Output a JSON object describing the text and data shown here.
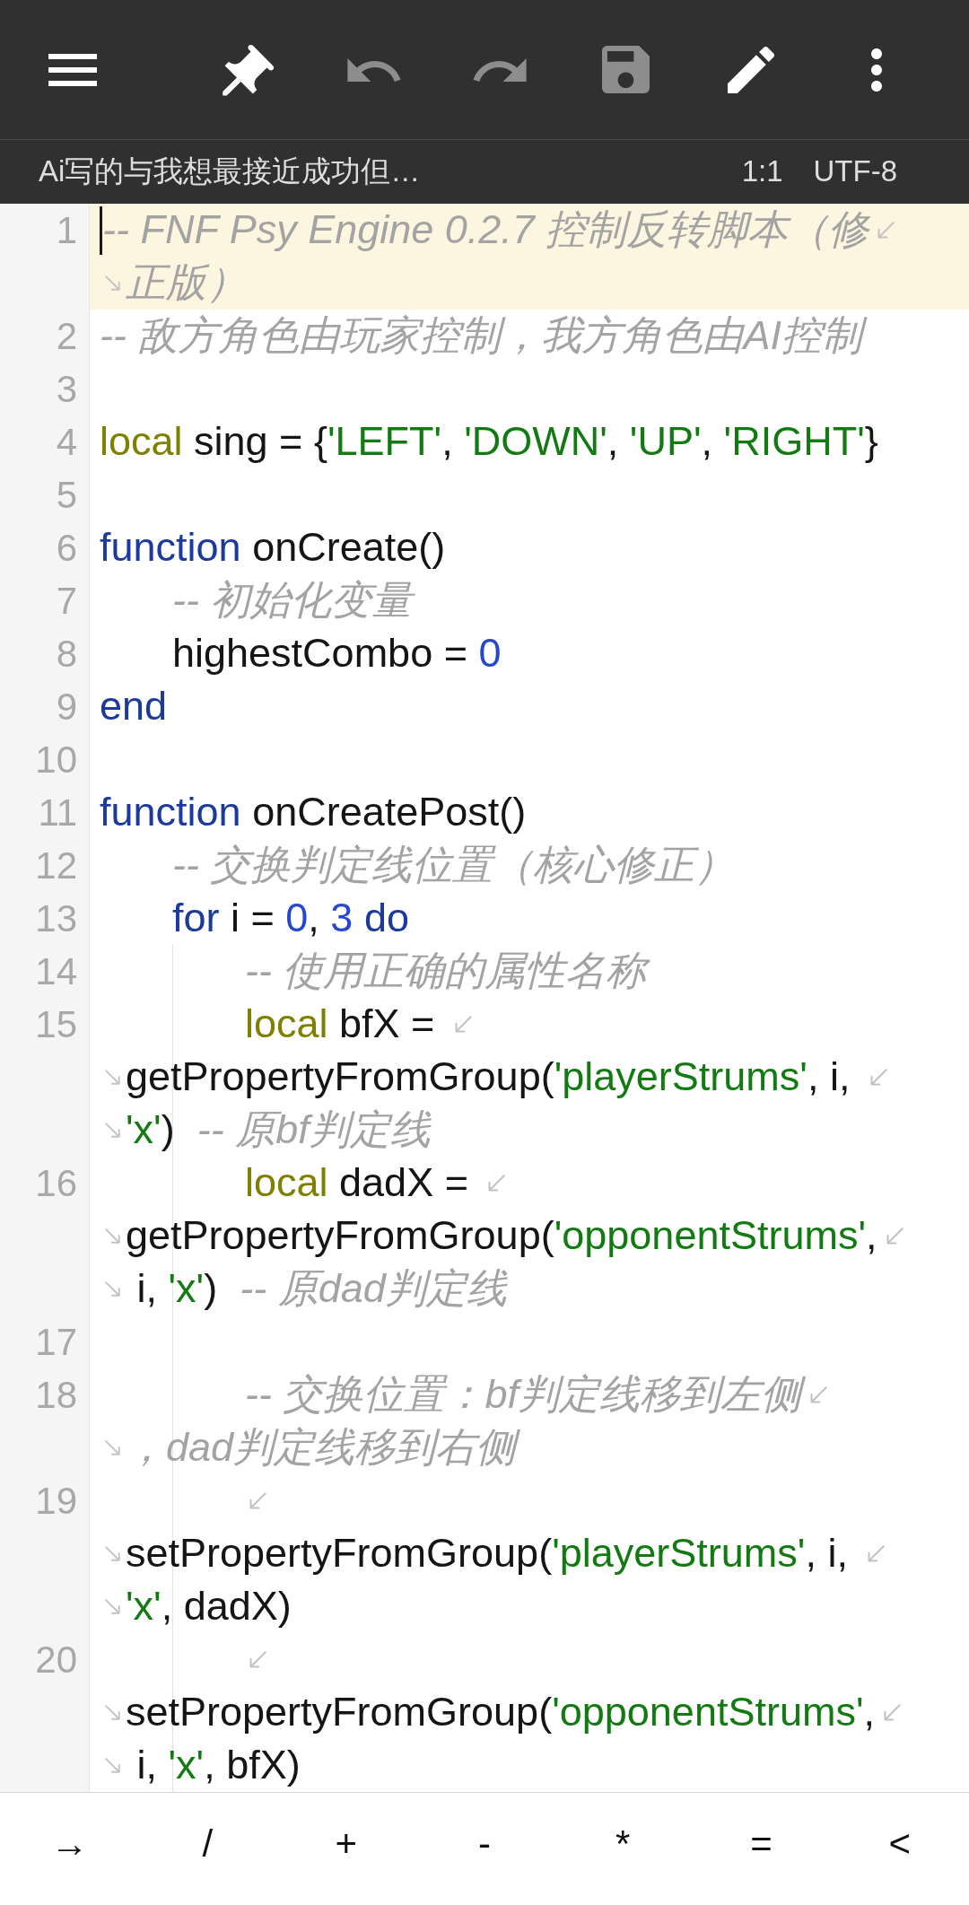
{
  "toolbar": {
    "buttons": [
      {
        "kind": "menu",
        "disabled": false
      },
      {
        "kind": "pin",
        "disabled": false
      },
      {
        "kind": "undo",
        "disabled": true
      },
      {
        "kind": "redo",
        "disabled": true
      },
      {
        "kind": "save",
        "disabled": true
      },
      {
        "kind": "edit",
        "disabled": false
      },
      {
        "kind": "more",
        "disabled": false
      }
    ]
  },
  "status_bar": {
    "file_name": "Ai写的与我想最接近成功但…",
    "cursor_position": "1:1",
    "encoding": "UTF-8"
  },
  "editor": {
    "lines": [
      {
        "number": "1",
        "current": true,
        "rows": [
          {
            "wrap_start": false,
            "wrap_end": true,
            "segments": [
              {
                "kind": "comment",
                "text": "-- FNF Psy Engine 0.2.7 控制反转脚本（修"
              }
            ]
          },
          {
            "wrap_start": true,
            "wrap_end": false,
            "segments": [
              {
                "kind": "comment",
                "text": "正版）"
              }
            ]
          }
        ]
      },
      {
        "number": "2",
        "current": false,
        "rows": [
          {
            "wrap_start": false,
            "wrap_end": false,
            "segments": [
              {
                "kind": "comment",
                "text": "-- 敌方角色由玩家控制，我方角色由AI控制"
              }
            ]
          }
        ]
      },
      {
        "number": "3",
        "current": false
      },
      {
        "number": "4",
        "current": false,
        "rows": [
          {
            "wrap_start": false,
            "wrap_end": false,
            "segments": [
              {
                "kind": "modifier",
                "text": "local"
              },
              {
                "kind": "plain",
                "text": " sing = {"
              },
              {
                "kind": "string",
                "text": "'LEFT'"
              },
              {
                "kind": "plain",
                "text": ", "
              },
              {
                "kind": "string",
                "text": "'DOWN'"
              },
              {
                "kind": "plain",
                "text": ", "
              },
              {
                "kind": "string",
                "text": "'UP'"
              },
              {
                "kind": "plain",
                "text": ", "
              },
              {
                "kind": "string",
                "text": "'RIGHT'"
              },
              {
                "kind": "plain",
                "text": "}"
              }
            ]
          }
        ]
      },
      {
        "number": "5",
        "current": false
      },
      {
        "number": "6",
        "current": false,
        "rows": [
          {
            "wrap_start": false,
            "wrap_end": false,
            "segments": [
              {
                "kind": "keyword",
                "text": "function"
              },
              {
                "kind": "plain",
                "text": " onCreate()"
              }
            ]
          }
        ],
        "children": [
          {
            "number": "7",
            "current": false,
            "rows": [
              {
                "wrap_start": false,
                "wrap_end": false,
                "segments": [
                  {
                    "kind": "comment",
                    "text": "-- 初始化变量"
                  }
                ]
              }
            ]
          },
          {
            "number": "8",
            "current": false,
            "rows": [
              {
                "wrap_start": false,
                "wrap_end": false,
                "segments": [
                  {
                    "kind": "plain",
                    "text": "highestCombo = "
                  },
                  {
                    "kind": "number",
                    "text": "0"
                  }
                ]
              }
            ]
          }
        ]
      },
      {
        "number": "9",
        "current": false,
        "rows": [
          {
            "wrap_start": false,
            "wrap_end": false,
            "segments": [
              {
                "kind": "keyword",
                "text": "end"
              }
            ]
          }
        ]
      },
      {
        "number": "10",
        "current": false
      },
      {
        "number": "11",
        "current": false,
        "rows": [
          {
            "wrap_start": false,
            "wrap_end": false,
            "segments": [
              {
                "kind": "keyword",
                "text": "function"
              },
              {
                "kind": "plain",
                "text": " onCreatePost()"
              }
            ]
          }
        ],
        "children": [
          {
            "number": "12",
            "current": false,
            "rows": [
              {
                "wrap_start": false,
                "wrap_end": false,
                "segments": [
                  {
                    "kind": "comment",
                    "text": "-- 交换判定线位置（核心修正）"
                  }
                ]
              }
            ]
          },
          {
            "number": "13",
            "current": false,
            "rows": [
              {
                "wrap_start": false,
                "wrap_end": false,
                "segments": [
                  {
                    "kind": "keyword",
                    "text": "for"
                  },
                  {
                    "kind": "plain",
                    "text": " i = "
                  },
                  {
                    "kind": "number",
                    "text": "0"
                  },
                  {
                    "kind": "plain",
                    "text": ", "
                  },
                  {
                    "kind": "number",
                    "text": "3"
                  },
                  {
                    "kind": "keyword",
                    "text": " do"
                  }
                ]
              }
            ],
            "children": [
              {
                "number": "14",
                "current": false,
                "rows": [
                  {
                    "wrap_start": false,
                    "wrap_end": false,
                    "segments": [
                      {
                        "kind": "comment",
                        "text": "-- 使用正确的属性名称"
                      }
                    ]
                  }
                ]
              },
              {
                "number": "15",
                "current": false,
                "rows": [
                  {
                    "wrap_start": false,
                    "wrap_end": true,
                    "segments": [
                      {
                        "kind": "modifier",
                        "text": "local"
                      },
                      {
                        "kind": "plain",
                        "text": " bfX = "
                      }
                    ]
                  },
                  {
                    "wrap_start": true,
                    "wrap_end": true,
                    "segments": [
                      {
                        "kind": "plain",
                        "text": "getPropertyFromGroup("
                      },
                      {
                        "kind": "string",
                        "text": "'playerStrums'"
                      },
                      {
                        "kind": "plain",
                        "text": ", i, "
                      }
                    ]
                  },
                  {
                    "wrap_start": true,
                    "wrap_end": false,
                    "segments": [
                      {
                        "kind": "string",
                        "text": "'x'"
                      },
                      {
                        "kind": "plain",
                        "text": ")  "
                      },
                      {
                        "kind": "comment",
                        "text": "-- 原bf判定线"
                      }
                    ]
                  }
                ]
              },
              {
                "number": "16",
                "current": false,
                "rows": [
                  {
                    "wrap_start": false,
                    "wrap_end": true,
                    "segments": [
                      {
                        "kind": "modifier",
                        "text": "local"
                      },
                      {
                        "kind": "plain",
                        "text": " dadX = "
                      }
                    ]
                  },
                  {
                    "wrap_start": true,
                    "wrap_end": true,
                    "segments": [
                      {
                        "kind": "plain",
                        "text": "getPropertyFromGroup("
                      },
                      {
                        "kind": "string",
                        "text": "'opponentStrums'"
                      },
                      {
                        "kind": "plain",
                        "text": ","
                      }
                    ]
                  },
                  {
                    "wrap_start": true,
                    "wrap_end": false,
                    "segments": [
                      {
                        "kind": "plain",
                        "text": " i, "
                      },
                      {
                        "kind": "string",
                        "text": "'x'"
                      },
                      {
                        "kind": "plain",
                        "text": ")  "
                      },
                      {
                        "kind": "comment",
                        "text": "-- 原dad判定线"
                      }
                    ]
                  }
                ]
              },
              {
                "number": "17",
                "current": false
              },
              {
                "number": "18",
                "current": false,
                "rows": [
                  {
                    "wrap_start": false,
                    "wrap_end": true,
                    "segments": [
                      {
                        "kind": "comment",
                        "text": "-- 交换位置：bf判定线移到左侧"
                      }
                    ]
                  },
                  {
                    "wrap_start": true,
                    "wrap_end": false,
                    "segments": [
                      {
                        "kind": "comment",
                        "text": "，dad判定线移到右侧"
                      }
                    ]
                  }
                ]
              },
              {
                "number": "19",
                "current": false,
                "rows": [
                  {
                    "wrap_start": false,
                    "wrap_end": true
                  },
                  {
                    "wrap_start": true,
                    "wrap_end": true,
                    "segments": [
                      {
                        "kind": "plain",
                        "text": "setPropertyFromGroup("
                      },
                      {
                        "kind": "string",
                        "text": "'playerStrums'"
                      },
                      {
                        "kind": "plain",
                        "text": ", i, "
                      }
                    ]
                  },
                  {
                    "wrap_start": true,
                    "wrap_end": false,
                    "segments": [
                      {
                        "kind": "string",
                        "text": "'x'"
                      },
                      {
                        "kind": "plain",
                        "text": ", dadX)"
                      }
                    ]
                  }
                ]
              },
              {
                "number": "20",
                "current": false,
                "rows": [
                  {
                    "wrap_start": false,
                    "wrap_end": true
                  },
                  {
                    "wrap_start": true,
                    "wrap_end": true,
                    "segments": [
                      {
                        "kind": "plain",
                        "text": "setPropertyFromGroup("
                      },
                      {
                        "kind": "string",
                        "text": "'opponentStrums'"
                      },
                      {
                        "kind": "plain",
                        "text": ","
                      }
                    ]
                  },
                  {
                    "wrap_start": true,
                    "wrap_end": false,
                    "segments": [
                      {
                        "kind": "plain",
                        "text": " i, "
                      },
                      {
                        "kind": "string",
                        "text": "'x'"
                      },
                      {
                        "kind": "plain",
                        "text": ", bfX)"
                      }
                    ]
                  }
                ]
              }
            ]
          }
        ]
      }
    ]
  },
  "symbol_bar": {
    "keys": [
      "→",
      "/",
      "+",
      "-",
      "*",
      "=",
      "<"
    ]
  }
}
